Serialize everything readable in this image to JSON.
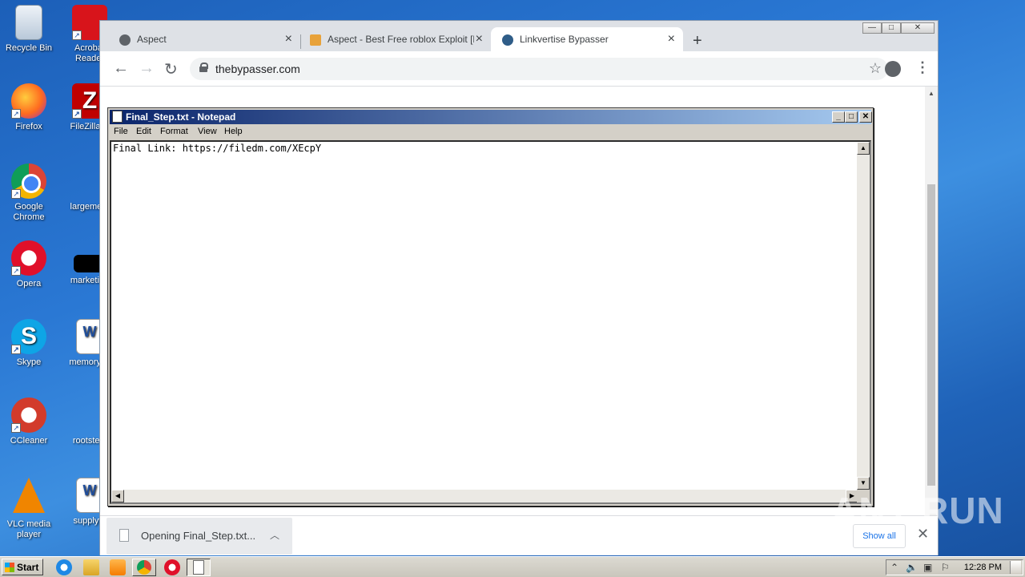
{
  "desktop": {
    "icons": [
      {
        "label": "Recycle Bin"
      },
      {
        "label": "Acrobat Reader"
      },
      {
        "label": "Firefox"
      },
      {
        "label": "FileZilla C"
      },
      {
        "label": "Google Chrome"
      },
      {
        "label": "largemem"
      },
      {
        "label": "Opera"
      },
      {
        "label": "marketing"
      },
      {
        "label": "Skype"
      },
      {
        "label": "memorypc"
      },
      {
        "label": "CCleaner"
      },
      {
        "label": "rootsteel"
      },
      {
        "label": "VLC media player"
      },
      {
        "label": "supplyfir"
      }
    ]
  },
  "browser": {
    "tabs": [
      {
        "title": "Aspect",
        "icon": "globe-icon",
        "active": false
      },
      {
        "title": "Aspect - Best Free roblox Exploit [N",
        "icon": "aspect-logo-icon",
        "active": false
      },
      {
        "title": "Linkvertise Bypasser",
        "icon": "linkvertise-icon",
        "active": true
      }
    ],
    "new_tab_symbol": "+",
    "url": "thebypasser.com",
    "window_buttons": {
      "minimize": "—",
      "maximize": "□",
      "close": "✕"
    }
  },
  "notepad": {
    "title": "Final_Step.txt - Notepad",
    "menu": [
      "File",
      "Edit",
      "Format",
      "View",
      "Help"
    ],
    "content": "Final Link: https://filedm.com/XEcpY"
  },
  "download_bar": {
    "item_text": "Opening Final_Step.txt...",
    "show_all_label": "Show all"
  },
  "taskbar": {
    "start_label": "Start",
    "clock": "12:28 PM"
  },
  "watermark": "ANY RUN"
}
